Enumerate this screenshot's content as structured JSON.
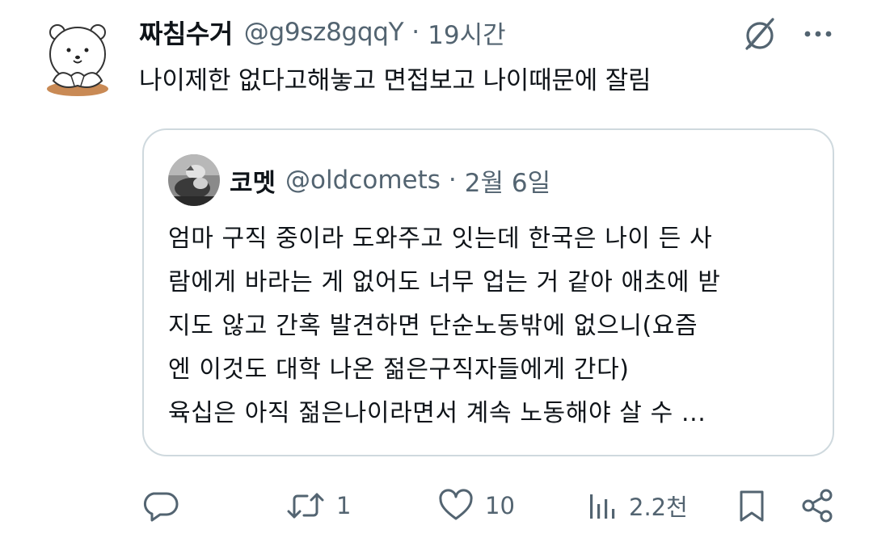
{
  "tweet": {
    "author_name": "짜침수거",
    "author_handle": "@g9sz8gqqY",
    "separator": "·",
    "time": "19시간",
    "text": "나이제한 없다고해놓고 면접보고 나이때문에 잘림"
  },
  "quoted_tweet": {
    "author_name": "코멧",
    "author_handle": "@oldcomets",
    "separator": "·",
    "date": "2월 6일",
    "lines": [
      "엄마 구직 중이라 도와주고 잇는데 한국은 나이 든 사",
      "람에게 바라는 게 없어도 너무 업는 거 같아 애초에 받",
      "지도 않고 간혹 발견하면 단순노동밖에 없으니(요즘",
      "엔 이것도 대학 나온 젊은구직자들에게 간다)",
      "육십은 아직 젊은나이라면서 계속 노동해야 살 수 ..."
    ]
  },
  "actions": {
    "reply_icon": "reply-icon",
    "retweet_icon": "retweet-icon",
    "retweet_count": "1",
    "like_icon": "heart-icon",
    "like_count": "10",
    "views_icon": "views-icon",
    "views_count": "2.2천",
    "bookmark_icon": "bookmark-icon",
    "share_icon": "share-icon"
  },
  "header_icons": {
    "grok": "grok-icon",
    "more": "more-icon"
  },
  "colors": {
    "text": "#0f1419",
    "secondary": "#536471",
    "border": "#cfd9de"
  }
}
